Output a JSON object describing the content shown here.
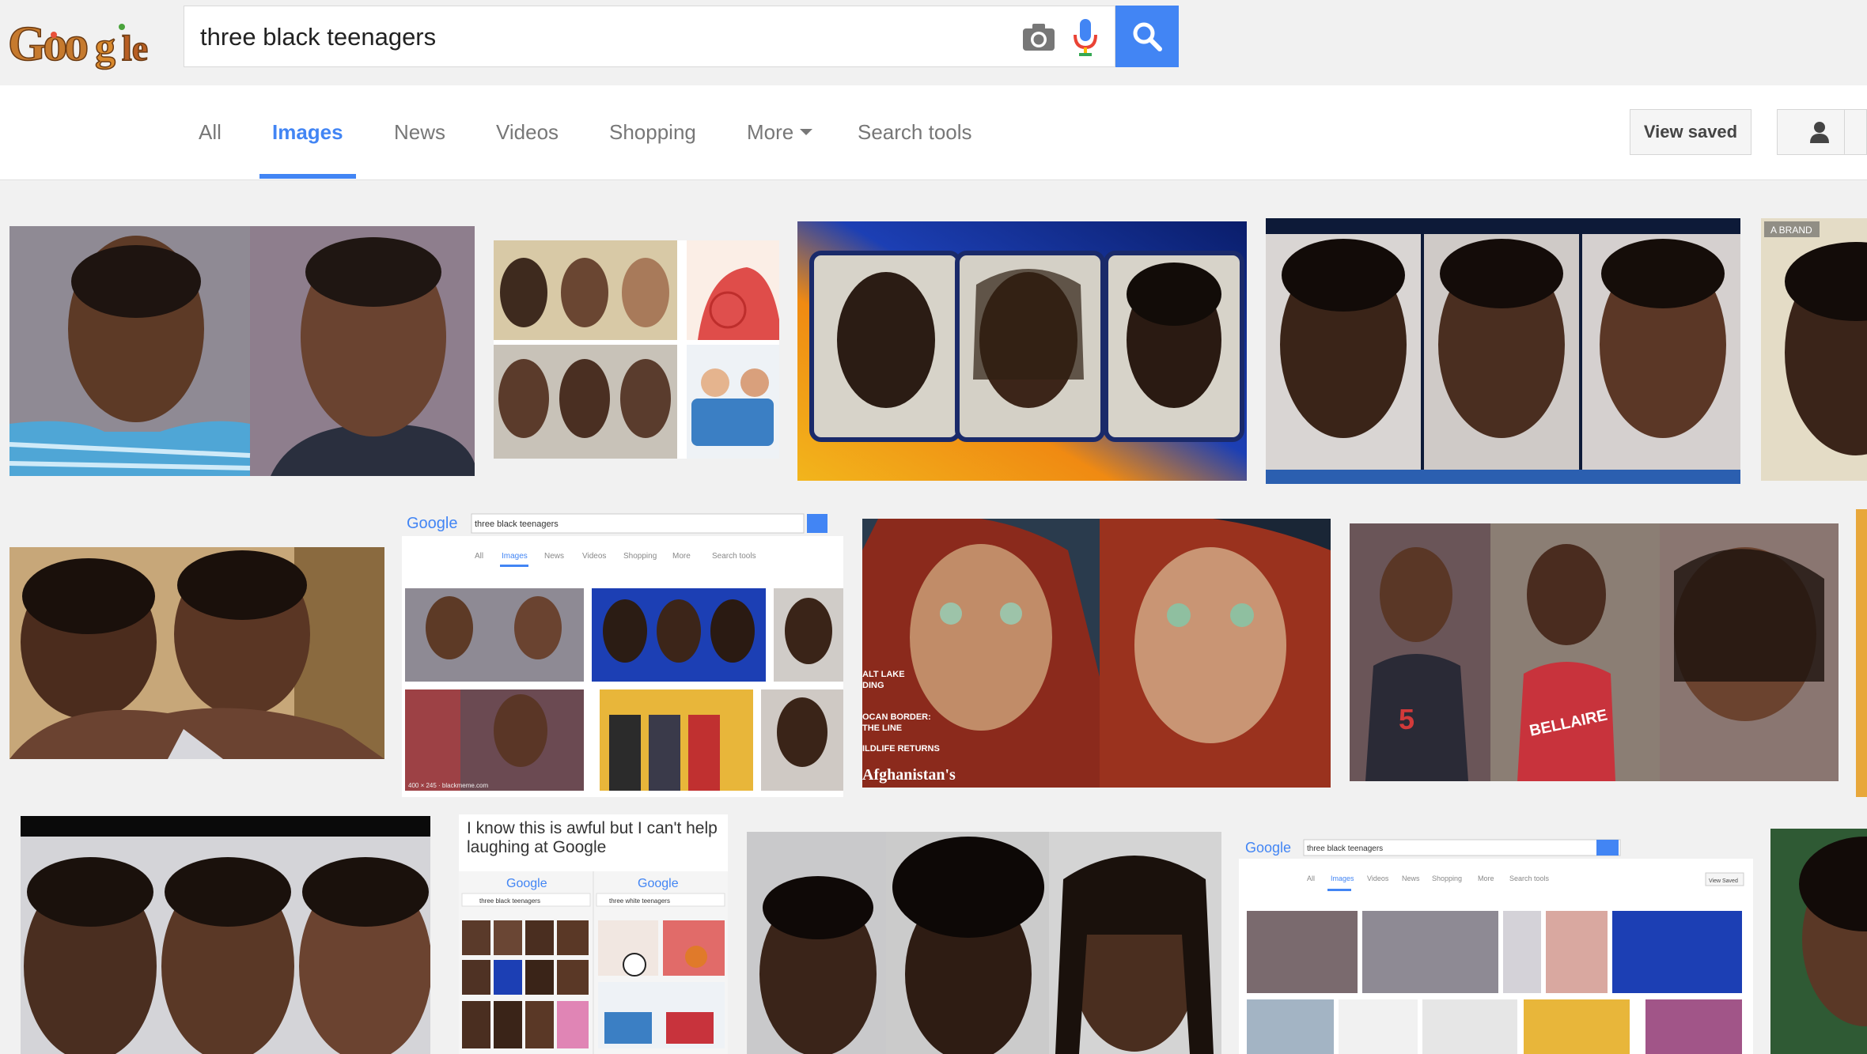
{
  "logo": {
    "text": "Google"
  },
  "search": {
    "query": "three black teenagers"
  },
  "nav": {
    "tabs": [
      "All",
      "Images",
      "News",
      "Videos",
      "Shopping",
      "More",
      "Search tools"
    ],
    "active_tab": "Images",
    "view_saved_label": "View saved"
  },
  "colors": {
    "accent": "#4285f4",
    "background": "#f1f1f1"
  },
  "results": {
    "meme_caption": "I know this is awful but I can't help laughing at Google",
    "screenshot_1": {
      "logo": "Google",
      "query": "three black teenagers",
      "tabs": [
        "All",
        "Images",
        "News",
        "Videos",
        "Shopping",
        "More",
        "Search tools"
      ],
      "footer": "400 × 245 · blackmeme.com"
    },
    "screenshot_2": {
      "logo": "Google",
      "query": "three black teenagers",
      "tabs": [
        "All",
        "Images",
        "Videos",
        "News",
        "Shopping",
        "More",
        "Search tools"
      ],
      "view_saved": "View Saved"
    },
    "meme_panels": {
      "logo": "Google",
      "left_query": "three black teenagers",
      "right_query": "three white teenagers"
    },
    "magazine_cover_lines": [
      "ALT LAKE",
      "DING",
      "OCAN BORDER:",
      "THE LINE",
      "ILDLIFE RETURNS",
      "Afghanistan's"
    ],
    "jersey_number": "5",
    "jersey_text": "BELLAIRE",
    "mugshot_tag": "A BRAND"
  }
}
